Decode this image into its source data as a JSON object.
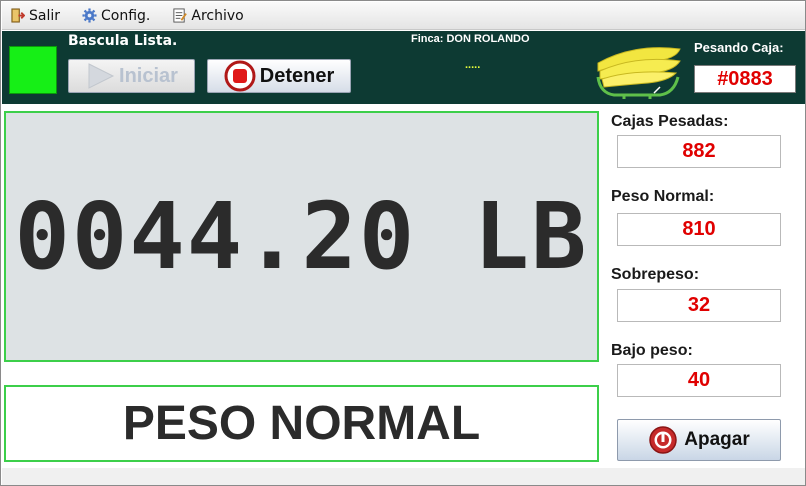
{
  "menu": {
    "items": [
      {
        "label": "Salir",
        "icon": "exit-icon"
      },
      {
        "label": "Config.",
        "icon": "gear-icon"
      },
      {
        "label": "Archivo",
        "icon": "document-icon"
      }
    ]
  },
  "header": {
    "status_text": "Bascula Lista.",
    "status_color": "#16ef16",
    "iniciar_label": "Iniciar",
    "detener_label": "Detener",
    "finca": "Finca: DON ROLANDO",
    "dots": ".....",
    "pesando_label": "Pesando Caja:",
    "pesando_value": "#0883"
  },
  "display": {
    "weight": "0044.20 LB",
    "result": "PESO NORMAL"
  },
  "stats": {
    "cajas_label": "Cajas Pesadas:",
    "cajas_value": "882",
    "normal_label": "Peso Normal:",
    "normal_value": "810",
    "sobrepeso_label": "Sobrepeso:",
    "sobrepeso_value": "32",
    "bajo_label": "Bajo peso:",
    "bajo_value": "40"
  },
  "apagar_label": "Apagar",
  "colors": {
    "header_bg": "#0d3a33",
    "accent_green": "#3ccf4a",
    "value_red": "#e00000"
  }
}
